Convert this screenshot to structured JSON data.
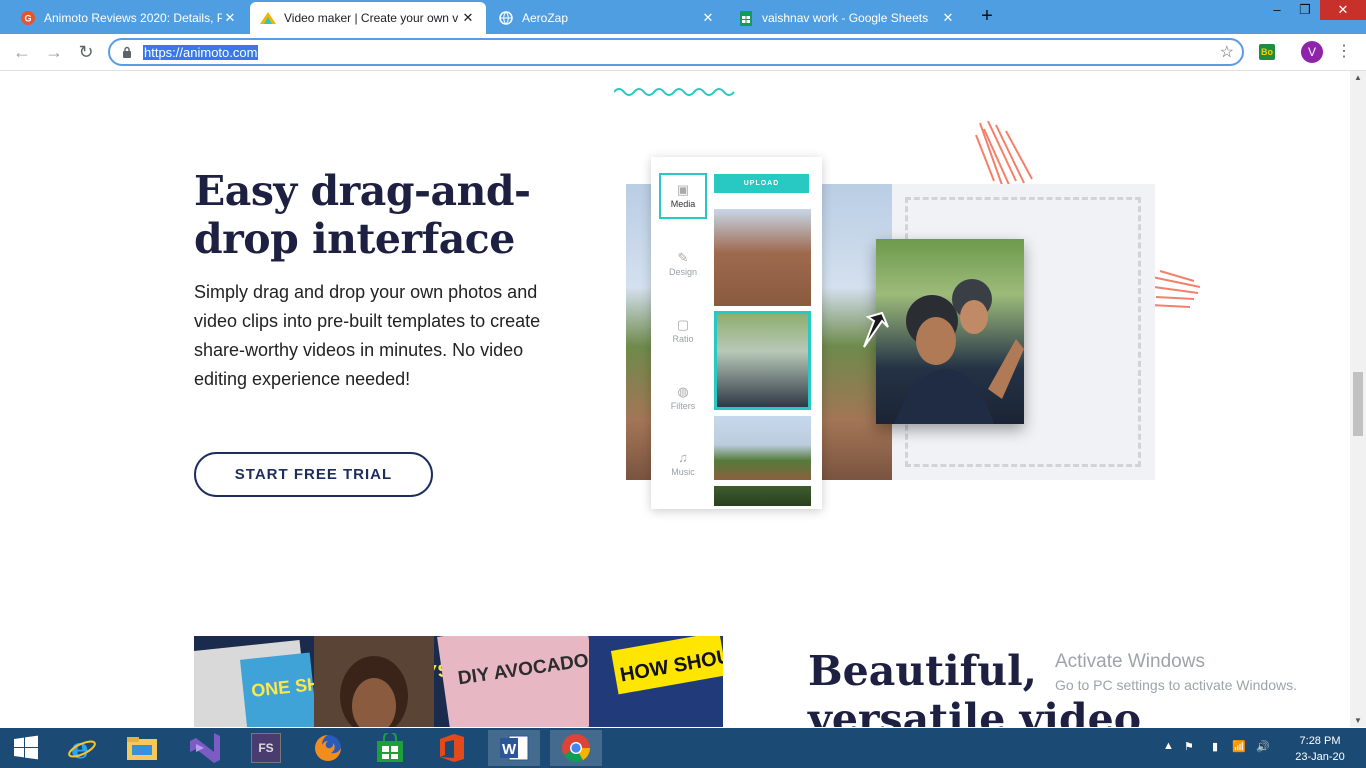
{
  "browser": {
    "tabs": [
      {
        "title": "Animoto Reviews 2020: Details, P",
        "active": false
      },
      {
        "title": "Video maker | Create your own v",
        "active": true
      },
      {
        "title": "AeroZap",
        "active": false
      },
      {
        "title": "vaishnav work - Google Sheets",
        "active": false
      }
    ],
    "url": "https://animoto.com",
    "extension_label": "Bo",
    "profile_initial": "V"
  },
  "section1": {
    "heading": "Easy drag-and-drop interface",
    "body": "Simply drag and drop your own photos and video clips into pre-built templates to create share-worthy videos in minutes. No video editing experience needed!",
    "cta": "START FREE TRIAL"
  },
  "editor": {
    "upload_label": "UPLOAD",
    "sidebar": [
      {
        "label": "Media",
        "icon": "media-icon",
        "selected": true
      },
      {
        "label": "Design",
        "icon": "design-icon",
        "selected": false
      },
      {
        "label": "Ratio",
        "icon": "ratio-icon",
        "selected": false
      },
      {
        "label": "Filters",
        "icon": "filters-icon",
        "selected": false
      },
      {
        "label": "Music",
        "icon": "music-icon",
        "selected": false
      }
    ]
  },
  "collage_text": {
    "t1": "ONE SHIRT FIVE WAYS",
    "t2": "DIY AVOCADO HAIR MASK",
    "t3": "HOW SHOULD YOUR HO"
  },
  "section2": {
    "heading": "Beautiful, versatile video"
  },
  "watermark": {
    "line1": "Activate Windows",
    "line2": "Go to PC settings to activate Windows."
  },
  "taskbar": {
    "apps": [
      "windows-start",
      "internet-explorer",
      "file-explorer",
      "visual-studio",
      "fs-app",
      "firefox",
      "store",
      "office",
      "word",
      "chrome"
    ],
    "time": "7:28 PM",
    "date": "23-Jan-20"
  },
  "colors": {
    "tab_bar": "#4f9ee2",
    "accent_teal": "#28c9c3",
    "heading_navy": "#1d2040",
    "taskbar": "#1b4b74"
  }
}
